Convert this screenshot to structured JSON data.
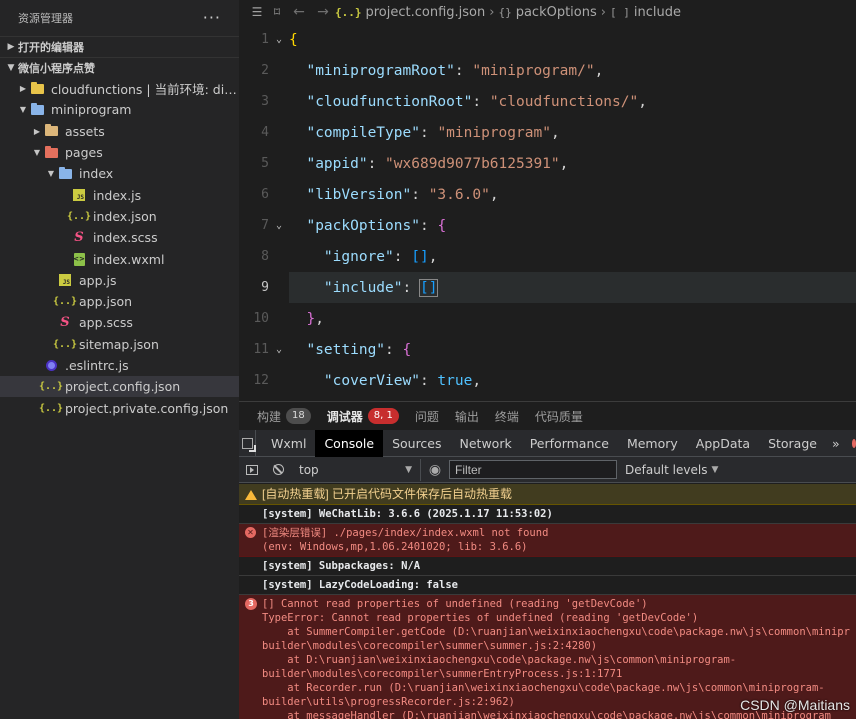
{
  "sidebar": {
    "title": "资源管理器",
    "more": "···",
    "sections": {
      "open_editors": "打开的编辑器",
      "project": "微信小程序点赞"
    },
    "tree": [
      {
        "label": "cloudfunctions | 当前环境: dian...",
        "icon": "cloud-folder-icon",
        "expanded": false,
        "depth": 1,
        "twisty": true
      },
      {
        "label": "miniprogram",
        "icon": "folder-open-icon",
        "expanded": true,
        "depth": 1,
        "twisty": true
      },
      {
        "label": "assets",
        "icon": "folder-icon",
        "expanded": false,
        "depth": 2,
        "twisty": true
      },
      {
        "label": "pages",
        "icon": "pages-folder-icon",
        "expanded": true,
        "depth": 2,
        "twisty": true
      },
      {
        "label": "index",
        "icon": "folder-open-icon",
        "expanded": true,
        "depth": 3,
        "twisty": true
      },
      {
        "label": "index.js",
        "icon": "js-file-icon",
        "depth": 4
      },
      {
        "label": "index.json",
        "icon": "json-file-icon",
        "depth": 4
      },
      {
        "label": "index.scss",
        "icon": "scss-file-icon",
        "depth": 4
      },
      {
        "label": "index.wxml",
        "icon": "wxml-file-icon",
        "depth": 4
      },
      {
        "label": "app.js",
        "icon": "js-file-icon",
        "depth": 3
      },
      {
        "label": "app.json",
        "icon": "json-file-icon",
        "depth": 3
      },
      {
        "label": "app.scss",
        "icon": "scss-file-icon",
        "depth": 3
      },
      {
        "label": "sitemap.json",
        "icon": "json-file-icon",
        "depth": 3
      },
      {
        "label": ".eslintrc.js",
        "icon": "eslint-file-icon",
        "depth": 2
      },
      {
        "label": "project.config.json",
        "icon": "json-file-icon",
        "depth": 2,
        "selected": true
      },
      {
        "label": "project.private.config.json",
        "icon": "json-file-icon",
        "depth": 2
      }
    ]
  },
  "editor": {
    "breadcrumbs": [
      "project.config.json",
      "packOptions",
      "include"
    ],
    "current_line": 9,
    "lines": [
      {
        "n": "1",
        "fold": true,
        "tokens": [
          {
            "t": "{",
            "c": "bracket"
          }
        ]
      },
      {
        "n": "2",
        "tokens": [
          {
            "t": "  "
          },
          {
            "t": "\"miniprogramRoot\"",
            "c": "k"
          },
          {
            "t": ": "
          },
          {
            "t": "\"miniprogram/\"",
            "c": "s"
          },
          {
            "t": ","
          }
        ]
      },
      {
        "n": "3",
        "tokens": [
          {
            "t": "  "
          },
          {
            "t": "\"cloudfunctionRoot\"",
            "c": "k"
          },
          {
            "t": ": "
          },
          {
            "t": "\"cloudfunctions/\"",
            "c": "s"
          },
          {
            "t": ","
          }
        ]
      },
      {
        "n": "4",
        "tokens": [
          {
            "t": "  "
          },
          {
            "t": "\"compileType\"",
            "c": "k"
          },
          {
            "t": ": "
          },
          {
            "t": "\"miniprogram\"",
            "c": "s"
          },
          {
            "t": ","
          }
        ]
      },
      {
        "n": "5",
        "tokens": [
          {
            "t": "  "
          },
          {
            "t": "\"appid\"",
            "c": "k"
          },
          {
            "t": ": "
          },
          {
            "t": "\"wx689d9077b6125391\"",
            "c": "s"
          },
          {
            "t": ","
          }
        ]
      },
      {
        "n": "6",
        "tokens": [
          {
            "t": "  "
          },
          {
            "t": "\"libVersion\"",
            "c": "k"
          },
          {
            "t": ": "
          },
          {
            "t": "\"3.6.0\"",
            "c": "s"
          },
          {
            "t": ","
          }
        ]
      },
      {
        "n": "7",
        "fold": true,
        "tokens": [
          {
            "t": "  "
          },
          {
            "t": "\"packOptions\"",
            "c": "k"
          },
          {
            "t": ": "
          },
          {
            "t": "{",
            "c": "bracket2"
          }
        ]
      },
      {
        "n": "8",
        "tokens": [
          {
            "t": "    "
          },
          {
            "t": "\"ignore\"",
            "c": "k"
          },
          {
            "t": ": "
          },
          {
            "t": "[]",
            "c": "bracket3"
          },
          {
            "t": ","
          }
        ]
      },
      {
        "n": "9",
        "tokens": [
          {
            "t": "    "
          },
          {
            "t": "\"include\"",
            "c": "k"
          },
          {
            "t": ": "
          },
          {
            "t": "[]",
            "c": "bracket3 hl-bracket"
          }
        ]
      },
      {
        "n": "10",
        "tokens": [
          {
            "t": "  "
          },
          {
            "t": "}",
            "c": "bracket2"
          },
          {
            "t": ","
          }
        ]
      },
      {
        "n": "11",
        "fold": true,
        "tokens": [
          {
            "t": "  "
          },
          {
            "t": "\"setting\"",
            "c": "k"
          },
          {
            "t": ": "
          },
          {
            "t": "{",
            "c": "bracket2"
          }
        ]
      },
      {
        "n": "12",
        "tokens": [
          {
            "t": "    "
          },
          {
            "t": "\"coverView\"",
            "c": "k"
          },
          {
            "t": ": "
          },
          {
            "t": "true",
            "c": "b"
          },
          {
            "t": ","
          }
        ]
      }
    ]
  },
  "panel": {
    "tabs": [
      {
        "label": "构建",
        "badge": "18",
        "badge_red": false
      },
      {
        "label": "调试器",
        "badge": "8, 1",
        "badge_red": true,
        "active": true
      },
      {
        "label": "问题"
      },
      {
        "label": "输出"
      },
      {
        "label": "终端"
      },
      {
        "label": "代码质量"
      }
    ]
  },
  "devtools": {
    "tabs": [
      "Wxml",
      "Console",
      "Sources",
      "Network",
      "Performance",
      "Memory",
      "AppData",
      "Storage"
    ],
    "active_tab": "Console",
    "more": "»",
    "context": "top",
    "filter_placeholder": "Filter",
    "levels": "Default levels"
  },
  "console": {
    "messages": [
      {
        "type": "warn",
        "lines": [
          "[自动热重载] 已开启代码文件保存后自动热重载"
        ]
      },
      {
        "type": "info",
        "lines": [
          "[system] WeChatLib: 3.6.6 (2025.1.17 11:53:02)"
        ]
      },
      {
        "type": "error",
        "icon": "error-icon",
        "lines": [
          "[渲染层错误] ./pages/index/index.wxml not found",
          "(env: Windows,mp,1.06.2401020; lib: 3.6.6)"
        ]
      },
      {
        "type": "info",
        "lines": [
          "[system] Subpackages: N/A"
        ]
      },
      {
        "type": "info",
        "lines": [
          "[system] LazyCodeLoading: false"
        ]
      },
      {
        "type": "error",
        "icon": "error-count",
        "count": "3",
        "lines": [
          "[] Cannot read properties of undefined (reading 'getDevCode')",
          "TypeError: Cannot read properties of undefined (reading 'getDevCode')",
          "    at SummerCompiler.getCode (D:\\ruanjian\\weixinxiaochengxu\\code\\package.nw\\js\\common\\minipr",
          "builder\\modules\\corecompiler\\summer\\summer.js:2:4280)",
          "    at D:\\ruanjian\\weixinxiaochengxu\\code\\package.nw\\js\\common\\miniprogram-",
          "builder\\modules\\corecompiler\\summerEntryProcess.js:1:1771",
          "    at Recorder.run (D:\\ruanjian\\weixinxiaochengxu\\code\\package.nw\\js\\common\\miniprogram-",
          "builder\\utils\\progressRecorder.js:2:962)",
          "    at messageHandler (D:\\ruanjian\\weixinxiaochengxu\\code\\package.nw\\js\\common\\miniprogram"
        ]
      }
    ]
  },
  "watermark": "CSDN @Maitians",
  "colors": {
    "sidebar_bg": "#252526",
    "editor_bg": "#1e1e1e",
    "error_bg": "#4e1a1a",
    "warn_bg": "#413c1f",
    "accent_badge": "#c72e2e"
  }
}
